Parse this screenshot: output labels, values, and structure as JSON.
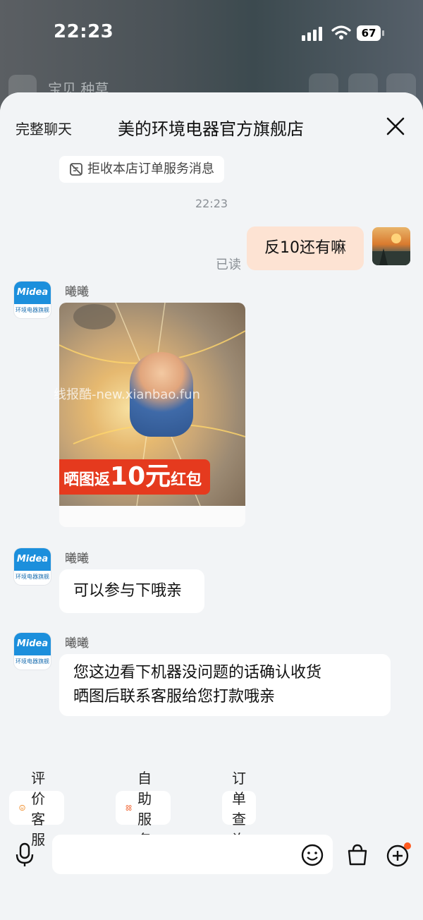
{
  "status_bar": {
    "time": "22:23",
    "battery": "67"
  },
  "background_nav": {
    "tabs": "宝贝  种草"
  },
  "header": {
    "full_chat": "完整聊天",
    "shop_name": "美的环境电器官方旗舰店"
  },
  "notice": {
    "reject_label": "拒收本店订单服务消息"
  },
  "chat": {
    "timestamp": "22:23",
    "messages": [
      {
        "from": "me",
        "text": "反10还有嘛",
        "status": "已读"
      },
      {
        "from": "shop",
        "sender": "曦曦",
        "type": "image",
        "banner_text": "晒图返",
        "banner_amount": "10元",
        "banner_suffix": "红包"
      },
      {
        "from": "shop",
        "sender": "曦曦",
        "text": "可以参与下哦亲"
      },
      {
        "from": "shop",
        "sender": "曦曦",
        "text_line1": "您这边看下机器没问题的话确认收货",
        "text_line2": "晒图后联系客服给您打款哦亲"
      }
    ]
  },
  "watermark": "线报酷-new.xianbao.fun",
  "shop_avatar": {
    "brand": "Midea",
    "caption": "环境电器旗舰店"
  },
  "quick_actions": [
    {
      "label": "评价客服",
      "icon": "smile-icon"
    },
    {
      "label": "自助服务",
      "icon": "grid-icon"
    },
    {
      "label": "订单查询",
      "icon": ""
    }
  ],
  "input": {
    "placeholder": ""
  },
  "colors": {
    "my_bubble": "#fde3d3",
    "sheet_bg": "#f2f4f6",
    "accent_dot": "#ff5a1f",
    "banner": "#e53a1e"
  }
}
